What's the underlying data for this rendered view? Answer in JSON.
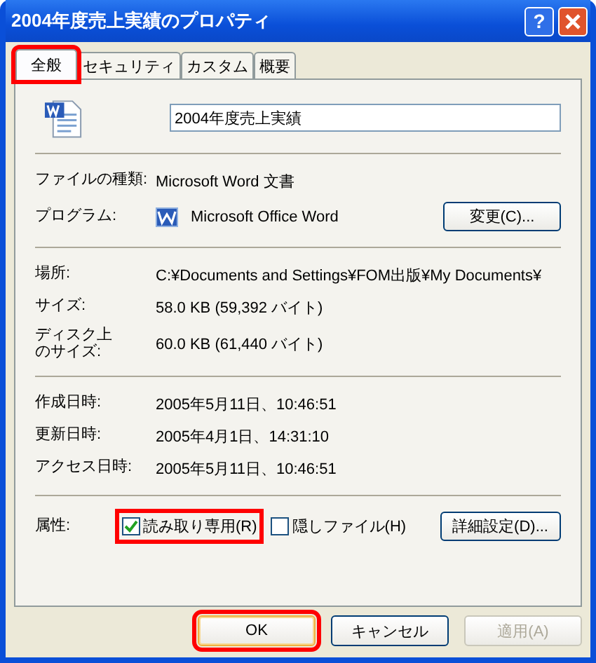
{
  "window": {
    "title": "2004年度売上実績のプロパティ",
    "help": "?"
  },
  "tabs": [
    {
      "label": "全般",
      "selected": true,
      "highlighted": true
    },
    {
      "label": "セキュリティ",
      "selected": false,
      "highlighted": false
    },
    {
      "label": "カスタム",
      "selected": false,
      "highlighted": false
    },
    {
      "label": "概要",
      "selected": false,
      "highlighted": false
    }
  ],
  "file_name": "2004年度売上実績",
  "sections": [
    [
      {
        "kind": "text",
        "label": "ファイルの種類:",
        "value": "Microsoft Word 文書"
      },
      {
        "kind": "program",
        "label": "プログラム:",
        "value": "Microsoft Office Word",
        "button": "変更(C)..."
      }
    ],
    [
      {
        "kind": "text",
        "label": "場所:",
        "value": "C:¥Documents and Settings¥FOM出版¥My Documents¥"
      },
      {
        "kind": "text",
        "label": "サイズ:",
        "value": "58.0 KB (59,392 バイト)"
      },
      {
        "kind": "narrow",
        "label": "ディスク上のサイズ:",
        "value": "60.0 KB (61,440 バイト)"
      }
    ],
    [
      {
        "kind": "text",
        "label": "作成日時:",
        "value": "2005年5月11日、10:46:51"
      },
      {
        "kind": "text",
        "label": "更新日時:",
        "value": "2005年4月1日、14:31:10"
      },
      {
        "kind": "text",
        "label": "アクセス日時:",
        "value": "2005年5月11日、10:46:51"
      }
    ]
  ],
  "attributes": {
    "label": "属性:",
    "checkboxes": [
      {
        "label": "読み取り専用(R)",
        "checked": true,
        "highlighted": true
      },
      {
        "label": "隠しファイル(H)",
        "checked": false,
        "highlighted": false
      }
    ],
    "button": "詳細設定(D)..."
  },
  "buttons": [
    {
      "label": "OK",
      "default": true,
      "disabled": false,
      "highlighted": true
    },
    {
      "label": "キャンセル",
      "default": false,
      "disabled": false,
      "highlighted": false
    },
    {
      "label": "適用(A)",
      "default": false,
      "disabled": true,
      "highlighted": false
    }
  ]
}
